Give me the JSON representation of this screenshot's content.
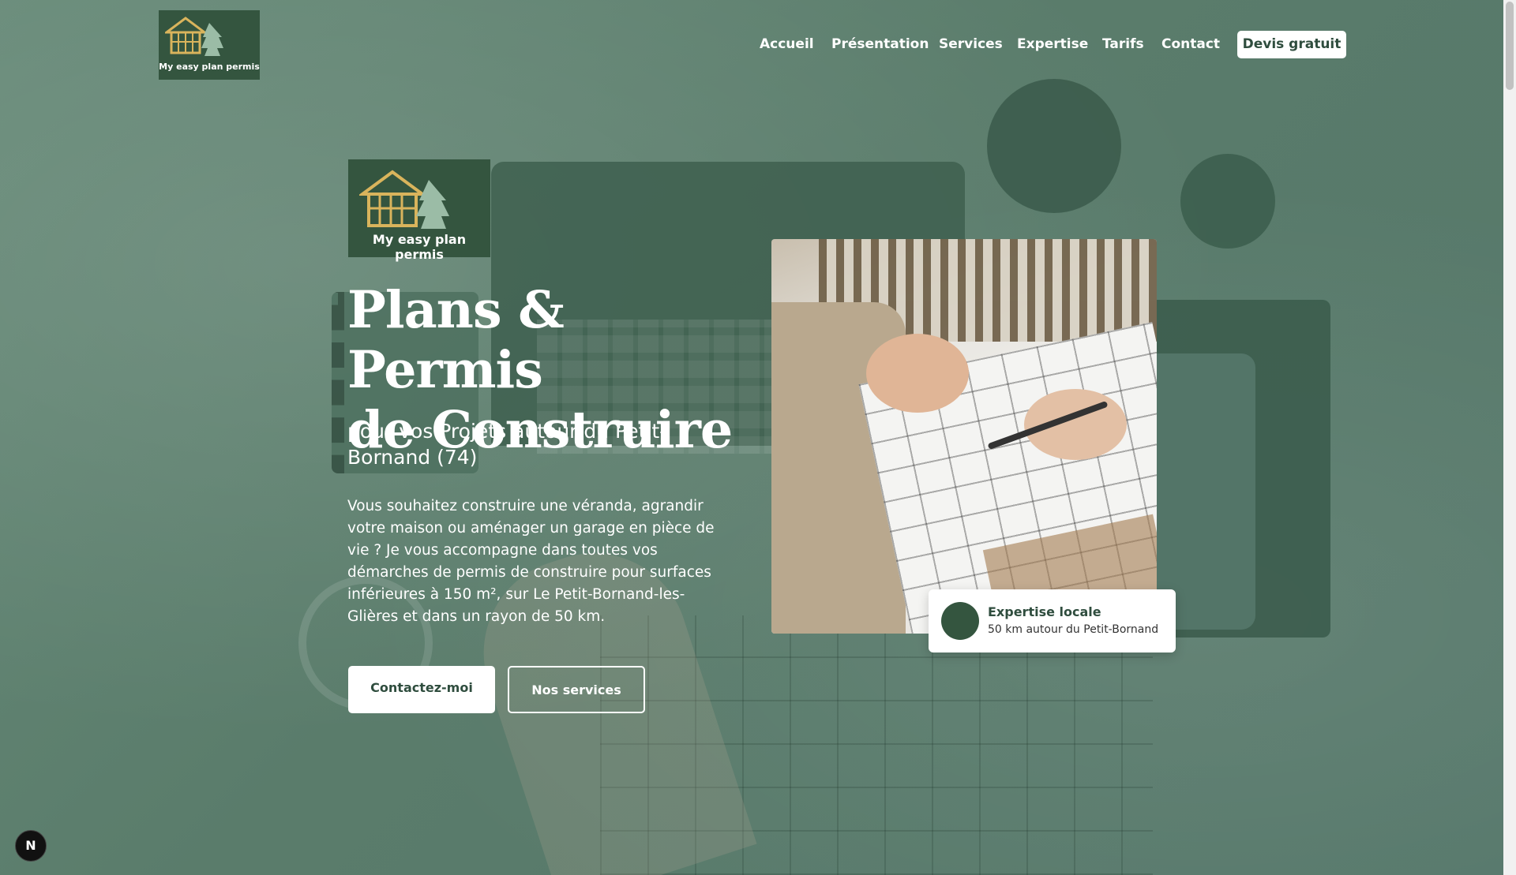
{
  "brand": {
    "name": "My easy plan permis"
  },
  "nav": {
    "items": [
      "Accueil",
      "Présentation",
      "Services",
      "Expertise",
      "Tarifs",
      "Contact"
    ],
    "cta_label": "Devis gratuit"
  },
  "hero": {
    "title_line1": "Plans & Permis",
    "title_line2": "de Construire",
    "subtitle": "pour vos Projets autour du Petit-Bornand (74)",
    "description": "Vous souhaitez construire une véranda, agrandir votre maison ou aménager un garage en pièce de vie ? Je vous accompagne dans toutes vos démarches de permis de construire pour surfaces inférieures à 150 m², sur Le Petit-Bornand-les-Glières et dans un rayon de 50 km.",
    "primary_button": "Contactez-moi",
    "secondary_button": "Nos services"
  },
  "badge": {
    "title": "Expertise locale",
    "subtitle": "50 km autour du Petit-Bornand"
  },
  "dev_indicator": {
    "label": "N"
  },
  "colors": {
    "brand_green": "#34553f",
    "overlay_green": "#5b7d6c",
    "logo_gold": "#d9b45c",
    "white": "#ffffff"
  }
}
